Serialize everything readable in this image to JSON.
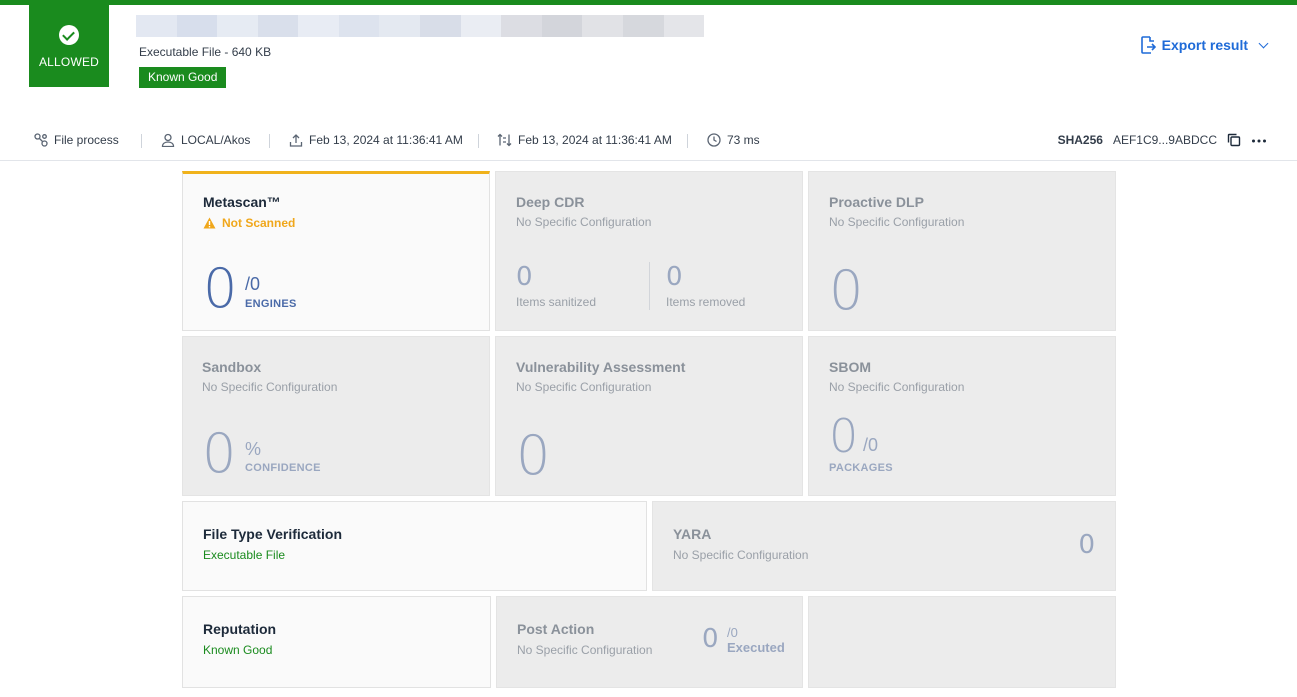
{
  "verdict": {
    "label": "ALLOWED",
    "color": "#1a8b1e"
  },
  "file": {
    "info": "Executable File - 640 KB",
    "badge": "Known Good"
  },
  "actions": {
    "export_label": "Export result"
  },
  "meta": {
    "process": "File process",
    "user": "LOCAL/Akos",
    "uploaded": "Feb 13, 2024 at 11:36:41 AM",
    "processed": "Feb 13, 2024 at 11:36:41 AM",
    "duration": "73 ms",
    "sha_label": "SHA256",
    "sha_value": "AEF1C9...9ABDCC"
  },
  "cards": {
    "metascan": {
      "title": "Metascan™",
      "status": "Not Scanned",
      "value": "0",
      "total": "/0",
      "label": "ENGINES"
    },
    "deep_cdr": {
      "title": "Deep CDR",
      "sub": "No Specific Configuration",
      "sanitized": "0",
      "sanitized_label": "Items sanitized",
      "removed": "0",
      "removed_label": "Items removed"
    },
    "dlp": {
      "title": "Proactive DLP",
      "sub": "No Specific Configuration",
      "value": "0"
    },
    "sandbox": {
      "title": "Sandbox",
      "sub": "No Specific Configuration",
      "value": "0",
      "unit": "%",
      "label": "CONFIDENCE"
    },
    "vuln": {
      "title": "Vulnerability Assessment",
      "sub": "No Specific Configuration",
      "value": "0"
    },
    "sbom": {
      "title": "SBOM",
      "sub": "No Specific Configuration",
      "value": "0",
      "total": "/0",
      "label": "PACKAGES"
    },
    "ftv": {
      "title": "File Type Verification",
      "status": "Executable File"
    },
    "yara": {
      "title": "YARA",
      "sub": "No Specific Configuration",
      "value": "0"
    },
    "reputation": {
      "title": "Reputation",
      "status": "Known Good"
    },
    "post_action": {
      "title": "Post Action",
      "sub": "No Specific Configuration",
      "value": "0",
      "total": "/0",
      "label": "Executed"
    }
  }
}
